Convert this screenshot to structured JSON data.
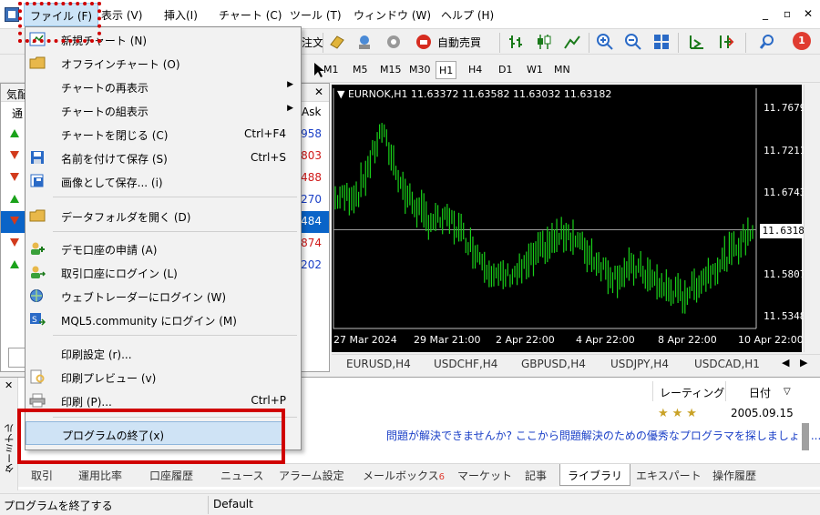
{
  "menubar": {
    "items": [
      "ファイル (F)",
      "表示 (V)",
      "挿入(I)",
      "チャート (C)",
      "ツール (T)",
      "ウィンドウ (W)",
      "ヘルプ (H)"
    ]
  },
  "toolbar": {
    "partial_label": "注文",
    "autotrade_label": "自動売買",
    "notification_count": "1"
  },
  "timeframes": [
    "M1",
    "M5",
    "M15",
    "M30",
    "H1",
    "H4",
    "D1",
    "W1",
    "MN"
  ],
  "timeframe_active": "H1",
  "market_watch": {
    "title_partial": "気配",
    "col_symbol_partial": "通",
    "col_ask": "Ask",
    "rows": [
      {
        "dir": "up",
        "ask": "958",
        "color": "#1a3fc7"
      },
      {
        "dir": "down",
        "ask": "803",
        "color": "#d01818"
      },
      {
        "dir": "down",
        "ask": "488",
        "color": "#d01818"
      },
      {
        "dir": "up",
        "ask": "270",
        "color": "#1a3fc7"
      },
      {
        "dir": "down",
        "ask": "484",
        "color": "#ffffff"
      },
      {
        "dir": "down",
        "ask": "874",
        "color": "#d01818"
      },
      {
        "dir": "up",
        "ask": "202",
        "color": "#1a3fc7"
      }
    ],
    "bottom_tab_partial": "通"
  },
  "chart": {
    "header": "EURNOK,H1  11.63372 11.63582 11.63032 11.63182",
    "prices": [
      "11.76790",
      "11.72110",
      "11.67430",
      "11.58070",
      "11.53480"
    ],
    "current_price": "11.63182",
    "times": [
      "27 Mar 2024",
      "29 Mar 21:00",
      "2 Apr 22:00",
      "4 Apr 22:00",
      "8 Apr 22:00",
      "10 Apr 22:00"
    ]
  },
  "chart_data": {
    "type": "line",
    "title": "EURNOK,H1",
    "x": [
      "27 Mar 2024",
      "29 Mar 21:00",
      "2 Apr 22:00",
      "4 Apr 22:00",
      "8 Apr 22:00",
      "10 Apr 22:00"
    ],
    "series": [
      {
        "name": "EURNOK,H1",
        "values": [
          11.666,
          11.672,
          11.742,
          11.672,
          11.642,
          11.642,
          11.61,
          11.578,
          11.586,
          11.612,
          11.63,
          11.604,
          11.58,
          11.59,
          11.57,
          11.558,
          11.582,
          11.604,
          11.632
        ]
      }
    ],
    "ylim": [
      11.5348,
      11.7679
    ],
    "grid": true
  },
  "chart_tabs": [
    "EURUSD,H4",
    "USDCHF,H4",
    "GBPUSD,H4",
    "USDJPY,H4",
    "USDCAD,H1"
  ],
  "library": {
    "col_rating": "レーティング",
    "col_date": "日付",
    "date_value": "2005.09.15",
    "link_text": "問題が解決できませんか? ここから問題解決のための優秀なプログラマを探しましょう..."
  },
  "terminal": {
    "vertical_label": "ターミナル",
    "tabs": [
      "取引",
      "運用比率",
      "口座履歴",
      "ニュース",
      "アラーム設定",
      "メールボックス",
      "マーケット",
      "記事",
      "ライブラリ",
      "エキスパート",
      "操作履歴"
    ],
    "mailbox_badge": "6",
    "active_tab": "ライブラリ"
  },
  "status": {
    "message": "プログラムを終了する",
    "profile": "Default"
  },
  "file_menu": {
    "items": [
      {
        "label": "新規チャート (N)",
        "icon": "new-chart-icon"
      },
      {
        "label": "オフラインチャート (O)",
        "icon": "folder-icon"
      },
      {
        "label": "チャートの再表示",
        "submenu": true
      },
      {
        "label": "チャートの組表示",
        "submenu": true
      },
      {
        "label": "チャートを閉じる (C)",
        "shortcut": "Ctrl+F4"
      },
      {
        "label": "名前を付けて保存 (S)",
        "shortcut": "Ctrl+S",
        "icon": "save-icon"
      },
      {
        "label": "画像として保存... (i)",
        "icon": "save-image-icon"
      },
      {
        "label": "データフォルダを開く (D)",
        "icon": "folder-icon"
      },
      {
        "label": "デモ口座の申請 (A)",
        "icon": "user-add-icon"
      },
      {
        "label": "取引口座にログイン (L)",
        "icon": "user-login-icon"
      },
      {
        "label": "ウェブトレーダーにログイン (W)",
        "icon": "globe-icon"
      },
      {
        "label": "MQL5.community にログイン (M)",
        "icon": "mql5-icon"
      },
      {
        "label": "印刷設定 (r)..."
      },
      {
        "label": "印刷プレビュー (v)",
        "icon": "print-preview-icon"
      },
      {
        "label": "印刷 (P)...",
        "shortcut": "Ctrl+P",
        "icon": "print-icon"
      },
      {
        "label": "プログラムの終了(x)"
      }
    ]
  }
}
